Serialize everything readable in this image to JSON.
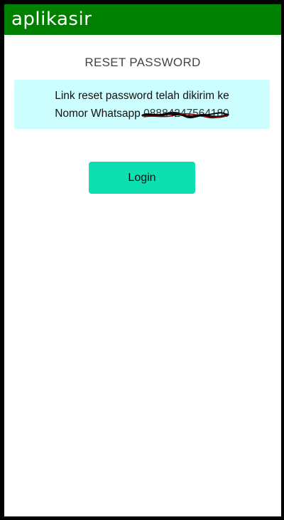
{
  "header": {
    "brand": "aplikasir",
    "background": "#008000"
  },
  "page": {
    "title": "RESET PASSWORD"
  },
  "alert": {
    "line1": "Link reset password telah dikirim ke",
    "line2_prefix": "Nomor Whatsapp",
    "phone_redacted": "08884247564180",
    "background": "#ccfdff"
  },
  "actions": {
    "login_label": "Login",
    "login_color": "#0ddfb0"
  }
}
